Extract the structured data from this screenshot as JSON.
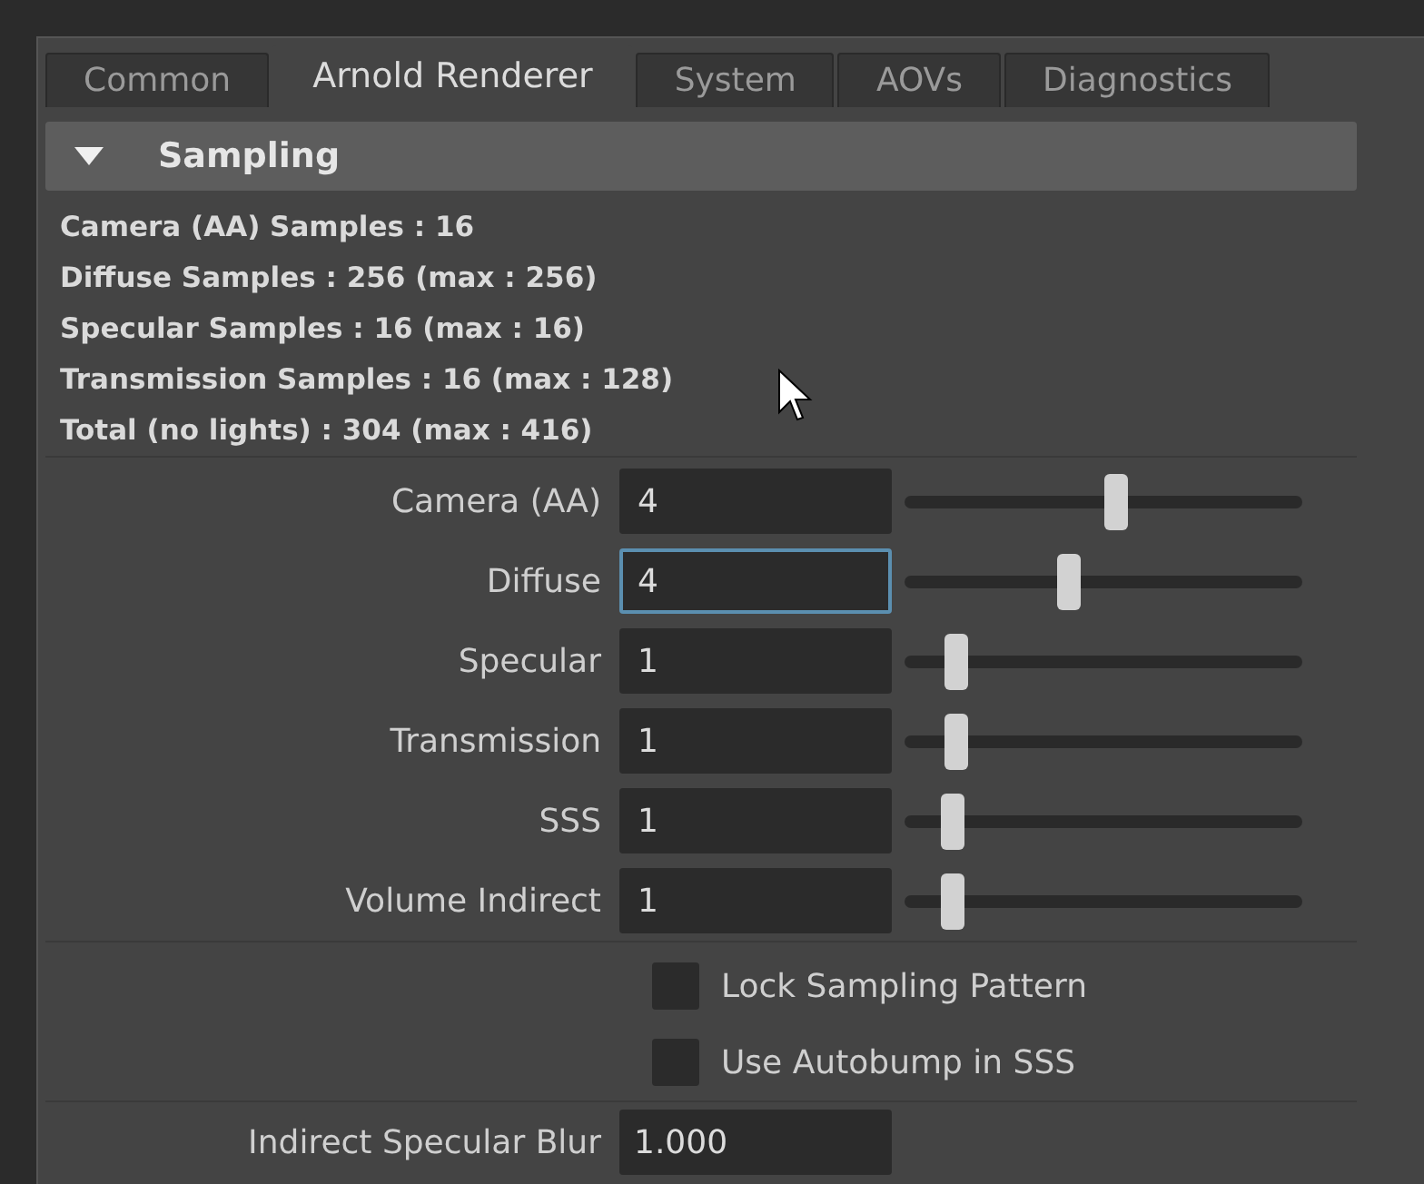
{
  "tabs": [
    {
      "label": "Common",
      "selected": false
    },
    {
      "label": "Arnold Renderer",
      "selected": true
    },
    {
      "label": "System",
      "selected": false
    },
    {
      "label": "AOVs",
      "selected": false
    },
    {
      "label": "Diagnostics",
      "selected": false
    }
  ],
  "section": {
    "title": "Sampling",
    "expanded": true
  },
  "summary": [
    "Camera (AA) Samples : 16",
    "Diffuse Samples : 256 (max : 256)",
    "Specular Samples : 16 (max : 16)",
    "Transmission Samples : 16 (max : 128)",
    "Total (no lights) : 304 (max : 416)"
  ],
  "samples": [
    {
      "label": "Camera (AA)",
      "value": "4",
      "focused": false,
      "level": 0.53
    },
    {
      "label": "Diffuse",
      "value": "4",
      "focused": true,
      "level": 0.41
    },
    {
      "label": "Specular",
      "value": "1",
      "focused": false,
      "level": 0.13
    },
    {
      "label": "Transmission",
      "value": "1",
      "focused": false,
      "level": 0.13
    },
    {
      "label": "SSS",
      "value": "1",
      "focused": false,
      "level": 0.12
    },
    {
      "label": "Volume Indirect",
      "value": "1",
      "focused": false,
      "level": 0.12
    }
  ],
  "options": [
    {
      "label": "Lock Sampling Pattern",
      "checked": false
    },
    {
      "label": "Use Autobump in SSS",
      "checked": false
    }
  ],
  "indirect_specular_blur": {
    "label": "Indirect Specular Blur",
    "value": "1.000"
  }
}
